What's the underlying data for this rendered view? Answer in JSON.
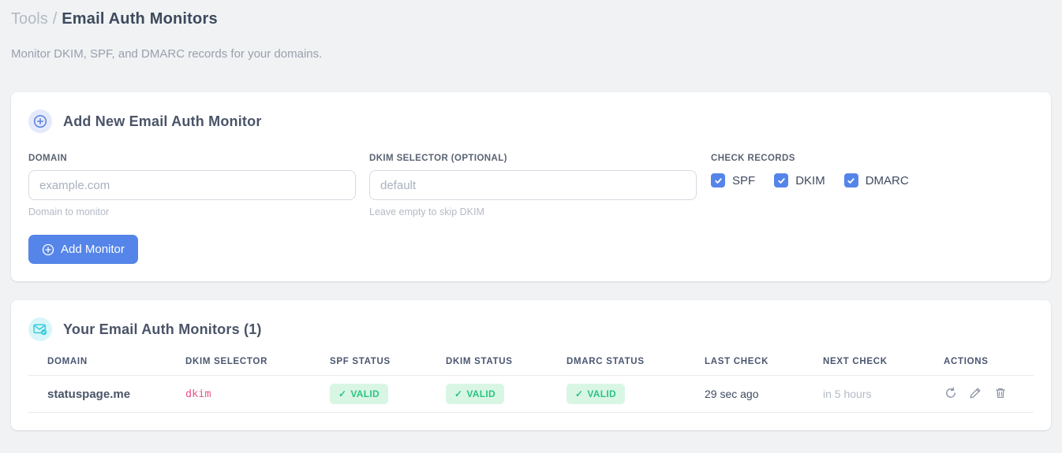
{
  "breadcrumb": {
    "section": "Tools",
    "separator": "/",
    "title": "Email Auth Monitors"
  },
  "subtitle": "Monitor DKIM, SPF, and DMARC records for your domains.",
  "glyphs": {
    "check": "✓"
  },
  "add_card": {
    "title": "Add New Email Auth Monitor",
    "icon": "plus-circle-icon",
    "domain_field": {
      "label": "DOMAIN",
      "placeholder": "example.com",
      "value": "",
      "hint": "Domain to monitor"
    },
    "dkim_field": {
      "label": "DKIM SELECTOR (OPTIONAL)",
      "placeholder": "default",
      "value": "",
      "hint": "Leave empty to skip DKIM"
    },
    "check_records": {
      "label": "CHECK RECORDS",
      "options": [
        {
          "label": "SPF",
          "checked": true
        },
        {
          "label": "DKIM",
          "checked": true
        },
        {
          "label": "DMARC",
          "checked": true
        }
      ]
    },
    "submit_label": "Add Monitor"
  },
  "monitors_card": {
    "title": "Your Email Auth Monitors (1)",
    "icon": "email-check-icon",
    "table": {
      "columns": [
        "DOMAIN",
        "DKIM SELECTOR",
        "SPF STATUS",
        "DKIM STATUS",
        "DMARC STATUS",
        "LAST CHECK",
        "NEXT CHECK",
        "ACTIONS"
      ],
      "rows": [
        {
          "domain": "statuspage.me",
          "dkim_selector": "dkim",
          "spf_status": "VALID",
          "dkim_status": "VALID",
          "dmarc_status": "VALID",
          "last_check": "29 sec ago",
          "next_check": "in 5 hours",
          "actions": [
            "refresh-icon",
            "edit-icon",
            "delete-icon"
          ]
        }
      ]
    }
  },
  "colors": {
    "accent_blue": "#5585e9",
    "header_icon_blue": "#5b7fe0",
    "icon_cyan": "#2bc9d9",
    "badge_green_bg": "#d9f6e5",
    "badge_green_text": "#2bc482",
    "code_pink": "#e8538c"
  }
}
